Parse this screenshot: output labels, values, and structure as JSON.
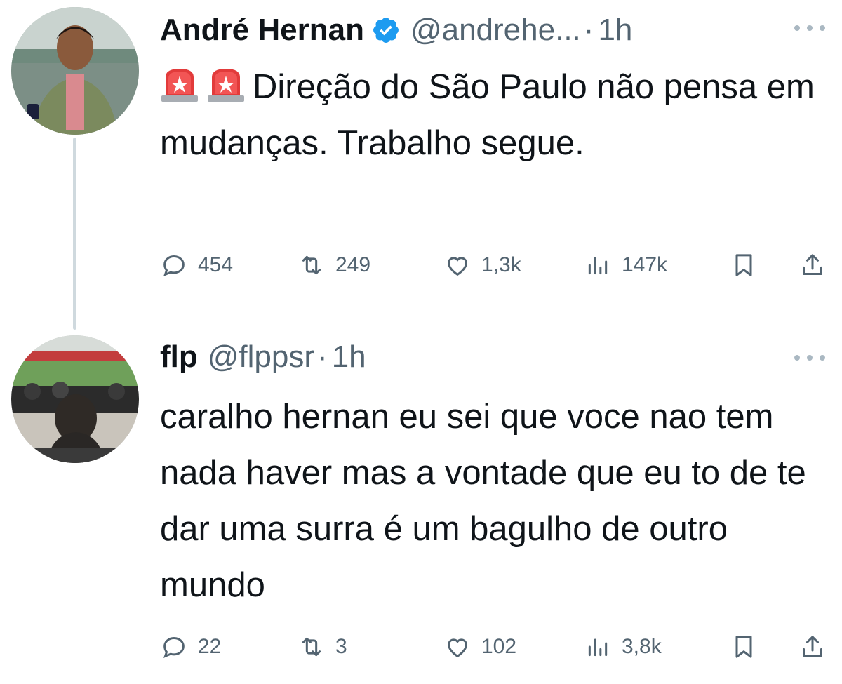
{
  "tweets": [
    {
      "author": {
        "name": "André Hernan",
        "verified": true,
        "handle": "@andrehe...",
        "separator": "·",
        "time": "1h",
        "avatar": "avatar-photo"
      },
      "text": "Direção do São Paulo não pensa em mudanças. Trabalho segue.",
      "leading_emoji": [
        "police-siren-icon",
        "police-siren-icon"
      ],
      "metrics": {
        "replies": "454",
        "retweets": "249",
        "likes": "1,3k",
        "views": "147k"
      }
    },
    {
      "author": {
        "name": "flp",
        "verified": false,
        "handle": "@flppsr",
        "separator": "·",
        "time": "1h",
        "avatar": "avatar-photo"
      },
      "text": "caralho hernan eu sei que voce nao tem nada haver mas a vontade que eu to de te dar uma surra é um bagulho de outro mundo",
      "metrics": {
        "replies": "22",
        "retweets": "3",
        "likes": "102",
        "views": "3,8k"
      }
    }
  ],
  "colors": {
    "text": "#0f1419",
    "secondary": "#536471",
    "verified_badge": "#1d9bf0",
    "thread_line": "#cfd9de"
  }
}
